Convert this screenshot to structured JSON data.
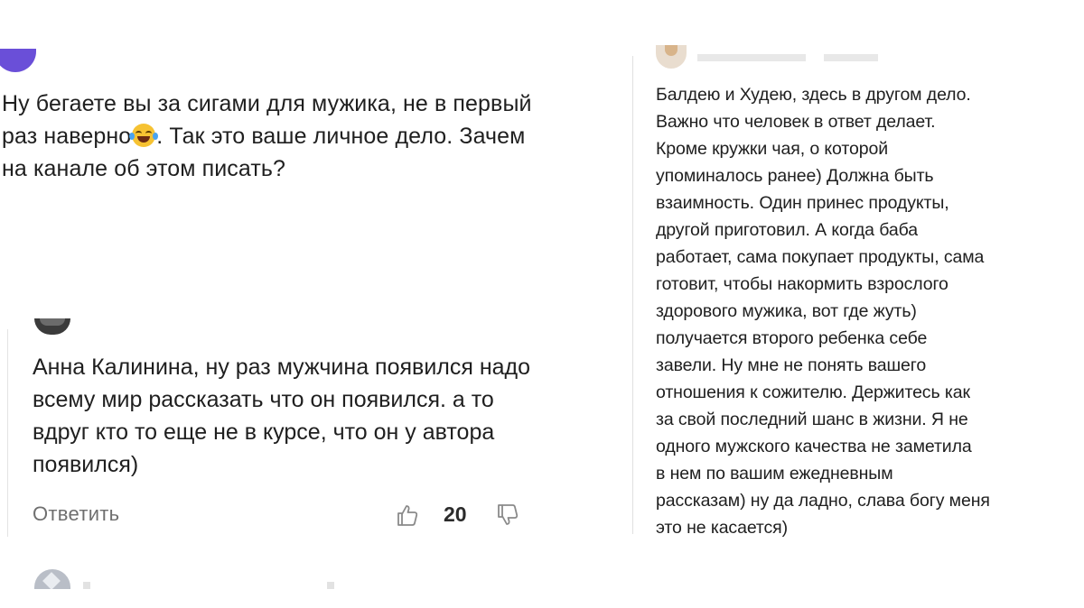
{
  "top_comment": {
    "text_part1": "Ну бегаете вы за сигами для мужика, не в первый раз наверно",
    "emoji": "face-with-tears-of-joy",
    "text_part2": ". Так это ваше личное дело. Зачем на канале об этом писать?"
  },
  "reply_comment": {
    "text": "Анна Калинина, ну раз мужчина появился надо всему мир рассказать что он появился. а то вдруг кто то еще не в курсе, что он у автора появился)",
    "reply_label": "Ответить",
    "like_count": "20",
    "icons": {
      "like": "thumb-up-icon",
      "dislike": "thumb-down-icon"
    }
  },
  "right_comment": {
    "text": "Балдею и Худею, здесь в другом дело.\nВажно что человек в ответ делает.\nКроме кружки чая, о которой\nупоминалось ранее) Должна быть\nвзаимность. Один принес продукты,\nдругой приготовил. А когда баба\nработает, сама покупает продукты, сама\nготовит, чтобы накормить взрослого\nздорового мужика, вот где жуть)\nполучается второго ребенка себе\nзавели. Ну мне не понять вашего\nотношения к сожителю. Держитесь как\nза свой последний шанс в жизни. Я не\nодного мужского качества не заметила\nв нем по вашим ежедневным\nрассказам) ну да ладно, слава богу меня\nэто не касается)"
  },
  "colors": {
    "background": "#ffffff",
    "text": "#1f1f1f",
    "muted": "#6f6f6f",
    "avatar_purple": "#6a4fd8"
  }
}
